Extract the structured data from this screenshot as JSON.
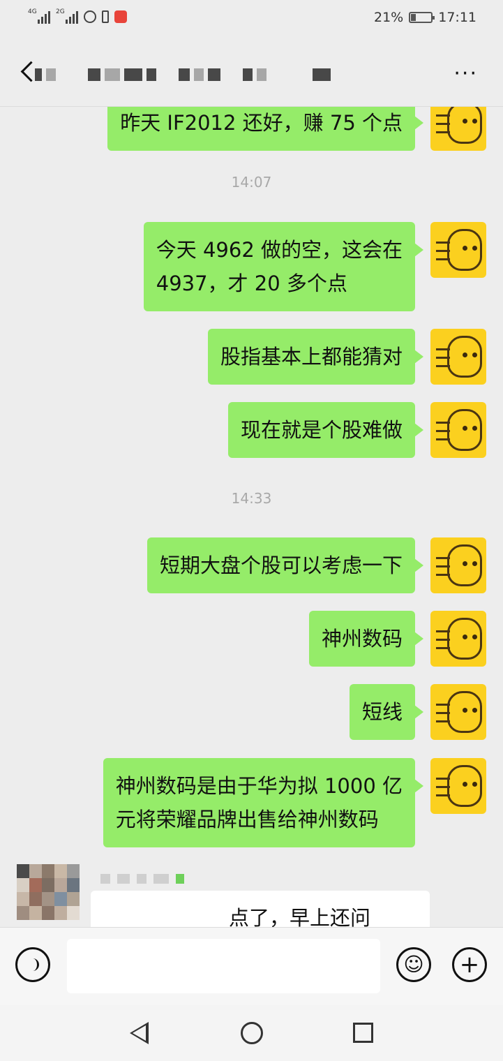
{
  "status_bar": {
    "network_1": "4G",
    "network_2": "2G",
    "battery_percent": "21%",
    "battery_level": 0.21,
    "time": "17:11"
  },
  "header": {
    "title": "",
    "more_label": "···",
    "back_icon": "chevron-left-icon",
    "more_icon": "more-dots-icon"
  },
  "chat": {
    "messages": [
      {
        "type": "sent",
        "text": "昨天 IF2012 还好，赚 75 个点"
      },
      {
        "type": "time",
        "text": "14:07"
      },
      {
        "type": "sent",
        "text": "今天 4962 做的空，这会在\n4937，才 20 多个点"
      },
      {
        "type": "sent",
        "text": "股指基本上都能猜对"
      },
      {
        "type": "sent",
        "text": "现在就是个股难做"
      },
      {
        "type": "time",
        "text": "14:33"
      },
      {
        "type": "sent",
        "text": "短期大盘个股可以考虑一下"
      },
      {
        "type": "sent",
        "text": "神州数码"
      },
      {
        "type": "sent",
        "text": "短线"
      },
      {
        "type": "sent",
        "text": "神州数码是由于华为拟 1000 亿\n元将荣耀品牌出售给神州数码"
      },
      {
        "type": "received",
        "sender": "",
        "text": "点了，早上还问"
      }
    ]
  },
  "input_bar": {
    "voice_icon": "voice-icon",
    "text_value": "",
    "emoji_icon": "emoji-icon",
    "plus_icon": "plus-icon",
    "plus_label": "+"
  },
  "nav_bar": {
    "back_icon": "nav-back-icon",
    "home_icon": "nav-home-icon",
    "recent_icon": "nav-recent-icon"
  },
  "colors": {
    "background": "#ededed",
    "sent_bubble": "#95ec69",
    "received_bubble": "#ffffff",
    "avatar": "#fbd01f",
    "timestamp": "#a8a8a8"
  }
}
